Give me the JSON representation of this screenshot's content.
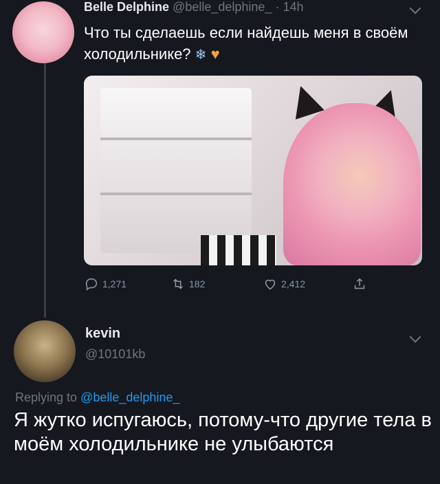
{
  "tweet": {
    "author_name": "Belle Delphine",
    "author_handle": "@belle_delphine_",
    "separator": "·",
    "time": "14h",
    "text": "Что ты сделаешь если найдешь меня в своём холодильнике?",
    "emoji_snowflake": "❄",
    "emoji_heart": "♥",
    "actions": {
      "reply_count": "1,271",
      "retweet_count": "182",
      "like_count": "2,412"
    }
  },
  "reply": {
    "author_name": "kevin",
    "author_handle": "@10101kb",
    "replying_prefix": "Replying to",
    "replying_to": "@belle_delphine_",
    "text": "Я жутко испугаюсь, потому-что другие тела в моём холодильнике не улыбаются"
  },
  "icons": [
    "chevron-down-icon",
    "reply-icon",
    "retweet-icon",
    "like-icon",
    "share-icon"
  ],
  "colors": {
    "background": "#15181f",
    "text": "#ffffff",
    "muted": "#6e767d",
    "link": "#1d9bf0",
    "thread_line": "#3a4047"
  }
}
